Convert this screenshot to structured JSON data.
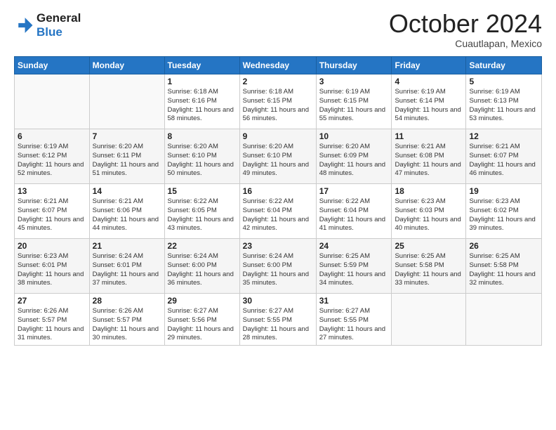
{
  "header": {
    "logo": {
      "line1": "General",
      "line2": "Blue"
    },
    "title": "October 2024",
    "subtitle": "Cuautlapan, Mexico"
  },
  "weekdays": [
    "Sunday",
    "Monday",
    "Tuesday",
    "Wednesday",
    "Thursday",
    "Friday",
    "Saturday"
  ],
  "weeks": [
    [
      {
        "day": "",
        "info": ""
      },
      {
        "day": "",
        "info": ""
      },
      {
        "day": "1",
        "info": "Sunrise: 6:18 AM\nSunset: 6:16 PM\nDaylight: 11 hours and 58 minutes."
      },
      {
        "day": "2",
        "info": "Sunrise: 6:18 AM\nSunset: 6:15 PM\nDaylight: 11 hours and 56 minutes."
      },
      {
        "day": "3",
        "info": "Sunrise: 6:19 AM\nSunset: 6:15 PM\nDaylight: 11 hours and 55 minutes."
      },
      {
        "day": "4",
        "info": "Sunrise: 6:19 AM\nSunset: 6:14 PM\nDaylight: 11 hours and 54 minutes."
      },
      {
        "day": "5",
        "info": "Sunrise: 6:19 AM\nSunset: 6:13 PM\nDaylight: 11 hours and 53 minutes."
      }
    ],
    [
      {
        "day": "6",
        "info": "Sunrise: 6:19 AM\nSunset: 6:12 PM\nDaylight: 11 hours and 52 minutes."
      },
      {
        "day": "7",
        "info": "Sunrise: 6:20 AM\nSunset: 6:11 PM\nDaylight: 11 hours and 51 minutes."
      },
      {
        "day": "8",
        "info": "Sunrise: 6:20 AM\nSunset: 6:10 PM\nDaylight: 11 hours and 50 minutes."
      },
      {
        "day": "9",
        "info": "Sunrise: 6:20 AM\nSunset: 6:10 PM\nDaylight: 11 hours and 49 minutes."
      },
      {
        "day": "10",
        "info": "Sunrise: 6:20 AM\nSunset: 6:09 PM\nDaylight: 11 hours and 48 minutes."
      },
      {
        "day": "11",
        "info": "Sunrise: 6:21 AM\nSunset: 6:08 PM\nDaylight: 11 hours and 47 minutes."
      },
      {
        "day": "12",
        "info": "Sunrise: 6:21 AM\nSunset: 6:07 PM\nDaylight: 11 hours and 46 minutes."
      }
    ],
    [
      {
        "day": "13",
        "info": "Sunrise: 6:21 AM\nSunset: 6:07 PM\nDaylight: 11 hours and 45 minutes."
      },
      {
        "day": "14",
        "info": "Sunrise: 6:21 AM\nSunset: 6:06 PM\nDaylight: 11 hours and 44 minutes."
      },
      {
        "day": "15",
        "info": "Sunrise: 6:22 AM\nSunset: 6:05 PM\nDaylight: 11 hours and 43 minutes."
      },
      {
        "day": "16",
        "info": "Sunrise: 6:22 AM\nSunset: 6:04 PM\nDaylight: 11 hours and 42 minutes."
      },
      {
        "day": "17",
        "info": "Sunrise: 6:22 AM\nSunset: 6:04 PM\nDaylight: 11 hours and 41 minutes."
      },
      {
        "day": "18",
        "info": "Sunrise: 6:23 AM\nSunset: 6:03 PM\nDaylight: 11 hours and 40 minutes."
      },
      {
        "day": "19",
        "info": "Sunrise: 6:23 AM\nSunset: 6:02 PM\nDaylight: 11 hours and 39 minutes."
      }
    ],
    [
      {
        "day": "20",
        "info": "Sunrise: 6:23 AM\nSunset: 6:01 PM\nDaylight: 11 hours and 38 minutes."
      },
      {
        "day": "21",
        "info": "Sunrise: 6:24 AM\nSunset: 6:01 PM\nDaylight: 11 hours and 37 minutes."
      },
      {
        "day": "22",
        "info": "Sunrise: 6:24 AM\nSunset: 6:00 PM\nDaylight: 11 hours and 36 minutes."
      },
      {
        "day": "23",
        "info": "Sunrise: 6:24 AM\nSunset: 6:00 PM\nDaylight: 11 hours and 35 minutes."
      },
      {
        "day": "24",
        "info": "Sunrise: 6:25 AM\nSunset: 5:59 PM\nDaylight: 11 hours and 34 minutes."
      },
      {
        "day": "25",
        "info": "Sunrise: 6:25 AM\nSunset: 5:58 PM\nDaylight: 11 hours and 33 minutes."
      },
      {
        "day": "26",
        "info": "Sunrise: 6:25 AM\nSunset: 5:58 PM\nDaylight: 11 hours and 32 minutes."
      }
    ],
    [
      {
        "day": "27",
        "info": "Sunrise: 6:26 AM\nSunset: 5:57 PM\nDaylight: 11 hours and 31 minutes."
      },
      {
        "day": "28",
        "info": "Sunrise: 6:26 AM\nSunset: 5:57 PM\nDaylight: 11 hours and 30 minutes."
      },
      {
        "day": "29",
        "info": "Sunrise: 6:27 AM\nSunset: 5:56 PM\nDaylight: 11 hours and 29 minutes."
      },
      {
        "day": "30",
        "info": "Sunrise: 6:27 AM\nSunset: 5:55 PM\nDaylight: 11 hours and 28 minutes."
      },
      {
        "day": "31",
        "info": "Sunrise: 6:27 AM\nSunset: 5:55 PM\nDaylight: 11 hours and 27 minutes."
      },
      {
        "day": "",
        "info": ""
      },
      {
        "day": "",
        "info": ""
      }
    ]
  ]
}
